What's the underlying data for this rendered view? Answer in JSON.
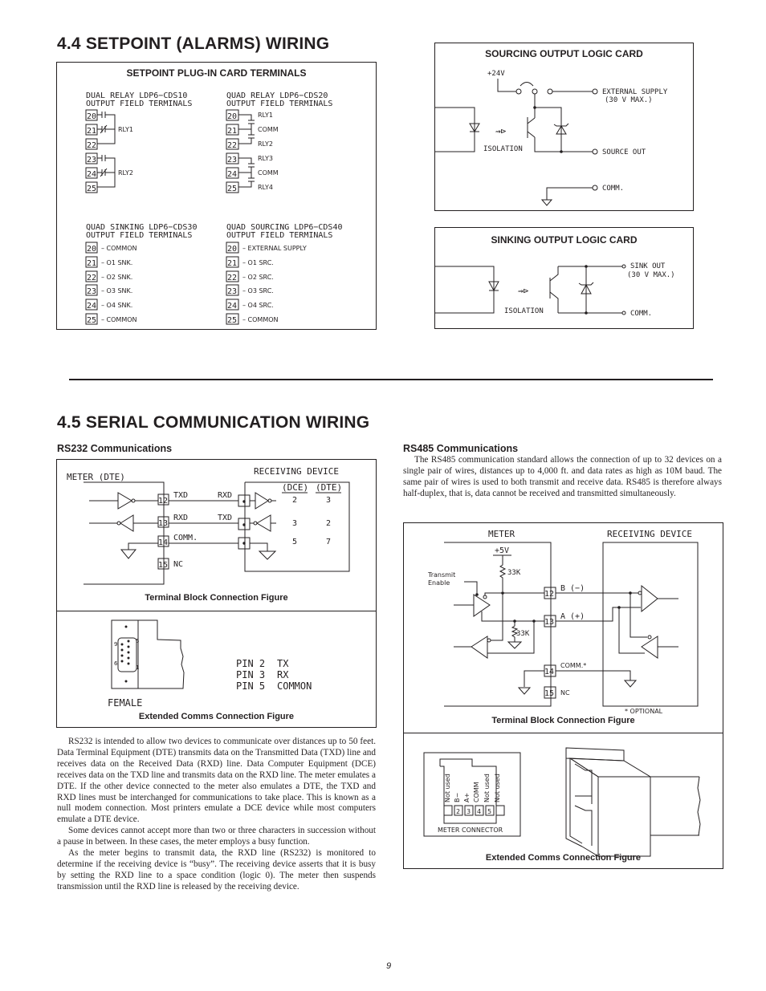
{
  "section_44": {
    "title": "4.4  SETPOINT (ALARMS) WIRING",
    "plugin_card": {
      "title": "SETPOINT PLUG-IN CARD TERMINALS",
      "dual_relay": {
        "heading_line1": "DUAL RELAY LDP6−CDS10",
        "heading_line2": "OUTPUT FIELD TERMINALS",
        "terminals": [
          "20",
          "21",
          "22",
          "23",
          "24",
          "25"
        ],
        "labels": [
          "RLY1",
          "RLY2"
        ]
      },
      "quad_relay": {
        "heading_line1": "QUAD RELAY LDP6−CDS20",
        "heading_line2": "OUTPUT FIELD TERMINALS",
        "terminals": [
          "20",
          "21",
          "22",
          "23",
          "24",
          "25"
        ],
        "labels": [
          "RLY1",
          "COMM",
          "RLY2",
          "RLY3",
          "COMM",
          "RLY4"
        ]
      },
      "quad_sinking": {
        "heading_line1": "QUAD SINKING LDP6−CDS30",
        "heading_line2": "OUTPUT FIELD TERMINALS",
        "terminals": [
          "20",
          "21",
          "22",
          "23",
          "24",
          "25"
        ],
        "labels": [
          "–  COMMON",
          "–  O1 SNK.",
          "–  O2 SNK.",
          "–  O3 SNK.",
          "–  O4 SNK.",
          "–  COMMON"
        ]
      },
      "quad_sourcing": {
        "heading_line1": "QUAD SOURCING LDP6−CDS40",
        "heading_line2": "OUTPUT FIELD TERMINALS",
        "terminals": [
          "20",
          "21",
          "22",
          "23",
          "24",
          "25"
        ],
        "labels": [
          "–  EXTERNAL SUPPLY",
          "–  O1 SRC.",
          "–  O2 SRC.",
          "–  O3 SRC.",
          "–  O4 SRC.",
          "–  COMMON"
        ]
      }
    },
    "sourcing_card": {
      "title": "SOURCING OUTPUT LOGIC CARD",
      "supply": "+24V",
      "isolation": "ISOLATION",
      "ext_supply_1": "EXTERNAL SUPPLY",
      "ext_supply_2": "(30 V MAX.)",
      "source_out": "SOURCE OUT",
      "comm": "COMM."
    },
    "sinking_card": {
      "title": "SINKING OUTPUT LOGIC CARD",
      "isolation": "ISOLATION",
      "sink_out_1": "SINK OUT",
      "sink_out_2": "(30 V MAX.)",
      "comm": "COMM."
    }
  },
  "section_45": {
    "title": "4.5  SERIAL COMMUNICATION WIRING",
    "rs232": {
      "heading": "RS232 Communications",
      "terminal_figure": {
        "meter_label": "METER (DTE)",
        "receiving_label": "RECEIVING DEVICE",
        "dce_label": "(DCE)",
        "dte_label": "(DTE)",
        "terminals": [
          "12",
          "13",
          "14",
          "15"
        ],
        "meter_signals": [
          "TXD",
          "RXD",
          "COMM.",
          "NC"
        ],
        "device_signals": [
          "RXD",
          "TXD"
        ],
        "dce_pins": [
          "2",
          "3",
          "5"
        ],
        "dte_pins": [
          "3",
          "2",
          "7"
        ],
        "caption": "Terminal Block Connection Figure"
      },
      "extended_figure": {
        "connector_type": "FEMALE",
        "pin_labels": [
          "9",
          "5",
          "6",
          "1"
        ],
        "pins": [
          {
            "pin": "PIN 2",
            "signal": "TX"
          },
          {
            "pin": "PIN 3",
            "signal": "RX"
          },
          {
            "pin": "PIN 5",
            "signal": "COMMON"
          }
        ],
        "caption": "Extended Comms Connection Figure"
      },
      "paragraphs": [
        "RS232 is intended to allow two devices to communicate over distances up to 50 feet. Data Terminal Equipment (DTE) transmits data on the Transmitted Data (TXD) line and receives data on the Received Data (RXD) line. Data Computer Equipment (DCE) receives data on the TXD line and transmits data on the RXD line. The meter emulates a DTE. If the other device connected to the meter also emulates a DTE, the TXD and RXD lines must be interchanged for communications to take place. This is known as a null modem connection. Most printers emulate a DCE device while most computers emulate a DTE device.",
        "Some devices cannot accept more than two or three characters in succession without a pause in between. In these cases, the meter employs a busy function.",
        "As the meter begins to transmit data, the RXD line (RS232) is monitored to determine if the receiving device is “busy”. The receiving device asserts that it is busy by setting the RXD line to a space condition (logic 0). The meter then suspends transmission until the RXD line is released by the receiving device."
      ]
    },
    "rs485": {
      "heading": "RS485 Communications",
      "paragraph": "The RS485 communication standard allows the connection of up to 32 devices on a single pair of wires, distances up to 4,000 ft. and data rates as high as 10M baud. The same pair of wires is used to both transmit and receive data. RS485 is therefore always half-duplex, that is, data cannot be received and transmitted simultaneously.",
      "terminal_figure": {
        "meter_label": "METER",
        "receiving_label": "RECEIVING DEVICE",
        "supply": "+5V",
        "resistor_1": "33K",
        "resistor_2": "33K",
        "transmit_enable_1": "Transmit",
        "transmit_enable_2": "Enable",
        "terminals": [
          "12",
          "13",
          "14",
          "15"
        ],
        "signals": [
          "B (−)",
          "A (+)",
          "COMM.*",
          "NC"
        ],
        "optional_note": "* OPTIONAL",
        "caption": "Terminal Block Connection Figure"
      },
      "extended_figure": {
        "connector_label": "METER CONNECTOR",
        "pin_names": [
          "Not used",
          "B−",
          "A+",
          "COMM",
          "Not used",
          "Not used"
        ],
        "pin_numbers": [
          "",
          "2",
          "3",
          "4",
          "5",
          ""
        ],
        "caption": "Extended Comms Connection Figure"
      }
    }
  },
  "page_number": "9"
}
